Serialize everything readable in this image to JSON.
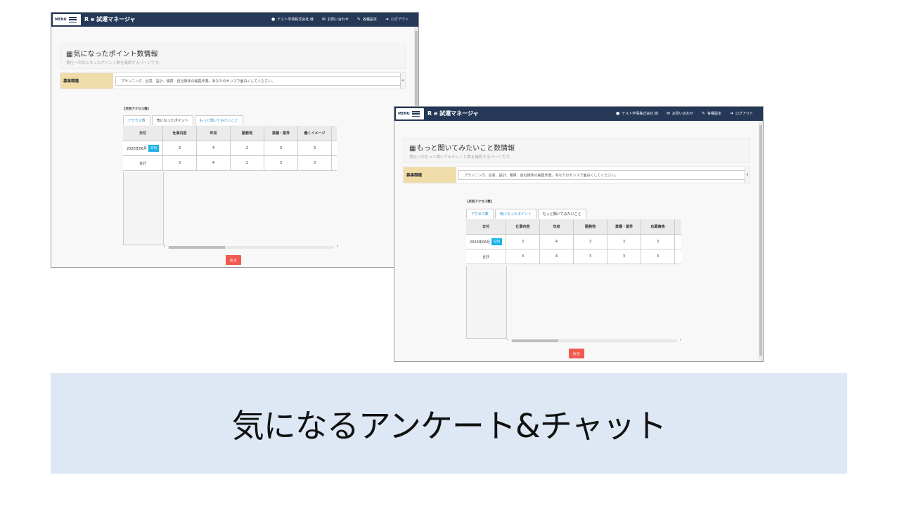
{
  "nav": {
    "menu_label": "MENU",
    "app_title": "R e 試運マネージャ",
    "user": "テスト学情株式会社.様",
    "contact": "お問い合わせ",
    "settings": "各種設定",
    "logout": "ログアウト"
  },
  "screen1": {
    "page_title": "気になったポイント数情報",
    "page_subtitle": "貴社への気になったポイント数を確認するページです。",
    "job_label": "募集職種",
    "job_value": "プランニング、合意、設計、積算：自社媒体の編集作業。あなたのセンスで面白くしてください。",
    "section_label": "【月別アクセス数】",
    "tabs": [
      "アクセス数",
      "気になったポイント",
      "もっと聞いてみたいこと"
    ],
    "columns": [
      "日付",
      "仕事内容",
      "年収",
      "勤務地",
      "業種・業界",
      "働くイメージ"
    ],
    "rows": [
      {
        "date": "2020年06月",
        "btn": "日別",
        "v1": "3",
        "v2": "4",
        "v3": "2",
        "v4": "3",
        "v5": "3"
      },
      {
        "date": "合計",
        "v1": "3",
        "v2": "4",
        "v3": "2",
        "v4": "3",
        "v5": "3"
      }
    ],
    "back_label": "戻る"
  },
  "screen2": {
    "page_title": "もっと聞いてみたいこと数情報",
    "page_subtitle": "貴社へのもっと聞いてみたいこと数を確認するページです。",
    "job_label": "募集職種",
    "job_value": "プランニング、合意、設計、積算：自社媒体の編集作業。あなたのセンスで面白くしてください。",
    "section_label": "【月別アクセス数】",
    "tabs": [
      "アクセス数",
      "気になったポイント",
      "もっと聞いてみたいこと"
    ],
    "columns": [
      "日付",
      "仕事内容",
      "年収",
      "勤務地",
      "業種・業界",
      "応募資格"
    ],
    "rows": [
      {
        "date": "2020年06月",
        "btn": "日別",
        "v1": "3",
        "v2": "4",
        "v3": "3",
        "v4": "3",
        "v5": "3"
      },
      {
        "date": "合計",
        "v1": "3",
        "v2": "4",
        "v3": "3",
        "v4": "3",
        "v5": "3"
      }
    ],
    "back_label": "戻る"
  },
  "banner_text": "気になるアンケート&チャット"
}
